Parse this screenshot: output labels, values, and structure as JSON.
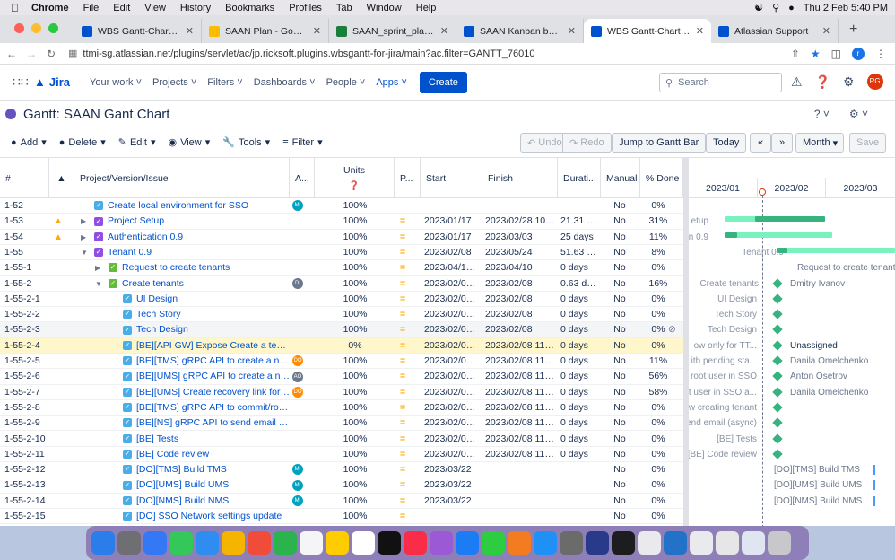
{
  "menubar": {
    "apple": "",
    "app": "Chrome",
    "items": [
      "File",
      "Edit",
      "View",
      "History",
      "Bookmarks",
      "Profiles",
      "Tab",
      "Window",
      "Help"
    ],
    "clock": "Thu 2 Feb  5:40 PM"
  },
  "tabs": [
    {
      "label": "WBS Gantt-Chart - Jira",
      "color": "#0052cc",
      "active": false
    },
    {
      "label": "SAAN Plan - Google Drive",
      "color": "#fbbc04",
      "active": false
    },
    {
      "label": "SAAN_sprint_planning.xl",
      "color": "#188038",
      "active": false
    },
    {
      "label": "SAAN Kanban board - Agi",
      "color": "#0052cc",
      "active": false
    },
    {
      "label": "WBS Gantt-Chart - Jira",
      "color": "#0052cc",
      "active": true
    },
    {
      "label": "Atlassian Support",
      "color": "#0052cc",
      "active": false
    }
  ],
  "address": {
    "url": "ttmi-sg.atlassian.net/plugins/servlet/ac/jp.ricksoft.plugins.wbsgantt-for-jira/main?ac.filter=GANTT_76010"
  },
  "jira": {
    "product": "Jira",
    "nav": [
      "Your work",
      "Projects",
      "Filters",
      "Dashboards",
      "People",
      "Apps"
    ],
    "active_nav": "Apps",
    "create_label": "Create",
    "search_placeholder": "Search",
    "avatar_initials": "RG"
  },
  "gantt_title": "Gantt:  SAAN Gant Chart",
  "toolbar": {
    "add": "Add",
    "delete": "Delete",
    "edit": "Edit",
    "view": "View",
    "tools": "Tools",
    "filter": "Filter",
    "undo": "Undo",
    "redo": "Redo",
    "jump": "Jump to Gantt Bar",
    "today": "Today",
    "scale": "Month",
    "save": "Save"
  },
  "columns": {
    "num": "#",
    "issue": "Project/Version/Issue",
    "assignee": "A...",
    "units": "Units",
    "priority": "P...",
    "start": "Start",
    "finish": "Finish",
    "duration": "Durati...",
    "manual": "Manual",
    "done": "% Done"
  },
  "timeline": {
    "months": [
      "2023/01",
      "2023/02",
      "2023/03"
    ]
  },
  "rows": [
    {
      "id": "1-55-2-4 ",
      "id_shown": "1-52",
      "warn": false,
      "indent": 0,
      "twist": "",
      "type": "check",
      "issue": "Create local environment for SSO",
      "assignee": "MI",
      "assignee_color": "#00a3bf",
      "units": "100%",
      "priority": "",
      "start": "",
      "finish": "",
      "duration": "",
      "manual": "No",
      "done": "0%"
    },
    {
      "id_shown": "1-53",
      "warn": true,
      "indent": 1,
      "twist": "▶",
      "type": "epic",
      "issue": "Project Setup",
      "assignee": "",
      "units": "100%",
      "priority": "=",
      "start": "2023/01/17",
      "finish": "2023/02/28 10:30",
      "duration": "21.31 d...",
      "manual": "No",
      "done": "31%"
    },
    {
      "id_shown": "1-54",
      "warn": true,
      "indent": 1,
      "twist": "▶",
      "type": "epic",
      "issue": "Authentication 0.9",
      "assignee": "",
      "units": "100%",
      "priority": "=",
      "start": "2023/01/17",
      "finish": "2023/03/03",
      "duration": "25 days",
      "manual": "No",
      "done": "11%"
    },
    {
      "id_shown": "1-55",
      "warn": false,
      "indent": 1,
      "twist": "▼",
      "type": "epic",
      "issue": "Tenant 0.9",
      "assignee": "",
      "units": "100%",
      "priority": "=",
      "start": "2023/02/08",
      "finish": "2023/05/24",
      "duration": "51.63 d...",
      "manual": "No",
      "done": "8%"
    },
    {
      "id_shown": "1-55-1",
      "warn": false,
      "indent": 2,
      "twist": "▶",
      "type": "story",
      "issue": "Request to create tenants",
      "assignee": "",
      "units": "100%",
      "priority": "=",
      "start": "2023/04/10 ...",
      "finish": "2023/04/10",
      "duration": "0 days",
      "manual": "No",
      "done": "0%"
    },
    {
      "id_shown": "1-55-2",
      "warn": false,
      "indent": 2,
      "twist": "▼",
      "type": "story",
      "issue": "Create tenants",
      "assignee": "DI",
      "assignee_color": "#6b778c",
      "units": "100%",
      "priority": "=",
      "start": "2023/02/08 ...",
      "finish": "2023/02/08",
      "duration": "0.63 da...",
      "manual": "No",
      "done": "16%"
    },
    {
      "id_shown": "1-55-2-1",
      "warn": false,
      "indent": 3,
      "twist": "",
      "type": "task",
      "issue": "UI Design",
      "assignee": "",
      "units": "100%",
      "priority": "=",
      "start": "2023/02/08 ...",
      "finish": "2023/02/08",
      "duration": "0 days",
      "manual": "No",
      "done": "0%"
    },
    {
      "id_shown": "1-55-2-2",
      "warn": false,
      "indent": 3,
      "twist": "",
      "type": "task",
      "issue": "Tech Story",
      "assignee": "",
      "units": "100%",
      "priority": "=",
      "start": "2023/02/08 ...",
      "finish": "2023/02/08",
      "duration": "0 days",
      "manual": "No",
      "done": "0%"
    },
    {
      "id_shown": "1-55-2-3",
      "warn": false,
      "indent": 3,
      "twist": "",
      "type": "task",
      "issue": "Tech Design",
      "assignee": "",
      "units": "100%",
      "priority": "=",
      "start": "2023/02/08 ...",
      "finish": "2023/02/08",
      "duration": "0 days",
      "manual": "No",
      "done": "0%"
    },
    {
      "id_shown": "1-55-2-4",
      "warn": false,
      "indent": 3,
      "twist": "",
      "type": "task",
      "issue": "[BE][API GW] Expose Create a tena...",
      "assignee": "",
      "units": "0%",
      "priority": "=",
      "start": "2023/02/08 ...",
      "finish": "2023/02/08 11:00",
      "duration": "0 days",
      "manual": "No",
      "done": "0%"
    },
    {
      "id_shown": "1-55-2-5",
      "warn": false,
      "indent": 3,
      "twist": "",
      "type": "task",
      "issue": "[BE][TMS] gRPC API to create a new...",
      "assignee": "DO",
      "assignee_color": "#ff8b00",
      "units": "100%",
      "priority": "=",
      "start": "2023/02/08 ...",
      "finish": "2023/02/08 11:00",
      "duration": "0 days",
      "manual": "No",
      "done": "11%"
    },
    {
      "id_shown": "1-55-2-6",
      "warn": false,
      "indent": 3,
      "twist": "",
      "type": "task",
      "issue": "[BE][UMS] gRPC API to create a ne...",
      "assignee": "AO",
      "assignee_color": "#6b778c",
      "units": "100%",
      "priority": "=",
      "start": "2023/02/08 ...",
      "finish": "2023/02/08 11:00",
      "duration": "0 days",
      "manual": "No",
      "done": "56%"
    },
    {
      "id_shown": "1-55-2-7",
      "warn": false,
      "indent": 3,
      "twist": "",
      "type": "task",
      "issue": "[BE][UMS] Create recovery link for ...",
      "assignee": "DO",
      "assignee_color": "#ff8b00",
      "units": "100%",
      "priority": "=",
      "start": "2023/02/08 ...",
      "finish": "2023/02/08 11:00",
      "duration": "0 days",
      "manual": "No",
      "done": "58%"
    },
    {
      "id_shown": "1-55-2-8",
      "warn": false,
      "indent": 3,
      "twist": "",
      "type": "task",
      "issue": "[BE][TMS] gRPC API to commit/rollb...",
      "assignee": "",
      "units": "100%",
      "priority": "=",
      "start": "2023/02/08 ...",
      "finish": "2023/02/08 11:00",
      "duration": "0 days",
      "manual": "No",
      "done": "0%"
    },
    {
      "id_shown": "1-55-2-9",
      "warn": false,
      "indent": 3,
      "twist": "",
      "type": "task",
      "issue": "[BE][NS] gRPC API to send email (as...",
      "assignee": "",
      "units": "100%",
      "priority": "=",
      "start": "2023/02/08 ...",
      "finish": "2023/02/08 11:00",
      "duration": "0 days",
      "manual": "No",
      "done": "0%"
    },
    {
      "id_shown": "1-55-2-10",
      "warn": false,
      "indent": 3,
      "twist": "",
      "type": "task",
      "issue": "[BE] Tests",
      "assignee": "",
      "units": "100%",
      "priority": "=",
      "start": "2023/02/08 ...",
      "finish": "2023/02/08 11:00",
      "duration": "0 days",
      "manual": "No",
      "done": "0%"
    },
    {
      "id_shown": "1-55-2-11",
      "warn": false,
      "indent": 3,
      "twist": "",
      "type": "task",
      "issue": "[BE] Code review",
      "assignee": "",
      "units": "100%",
      "priority": "=",
      "start": "2023/02/08 ...",
      "finish": "2023/02/08 11:00",
      "duration": "0 days",
      "manual": "No",
      "done": "0%"
    },
    {
      "id_shown": "1-55-2-12",
      "warn": false,
      "indent": 3,
      "twist": "",
      "type": "task",
      "issue": "[DO][TMS] Build TMS",
      "assignee": "MI",
      "assignee_color": "#00a3bf",
      "units": "100%",
      "priority": "=",
      "start": "2023/03/22",
      "finish": "",
      "duration": "",
      "manual": "No",
      "done": "0%"
    },
    {
      "id_shown": "1-55-2-13",
      "warn": false,
      "indent": 3,
      "twist": "",
      "type": "task",
      "issue": "[DO][UMS] Build UMS",
      "assignee": "MI",
      "assignee_color": "#00a3bf",
      "units": "100%",
      "priority": "=",
      "start": "2023/03/22",
      "finish": "",
      "duration": "",
      "manual": "No",
      "done": "0%"
    },
    {
      "id_shown": "1-55-2-14",
      "warn": false,
      "indent": 3,
      "twist": "",
      "type": "task",
      "issue": "[DO][NMS] Build NMS",
      "assignee": "MI",
      "assignee_color": "#00a3bf",
      "units": "100%",
      "priority": "=",
      "start": "2023/03/22",
      "finish": "",
      "duration": "",
      "manual": "No",
      "done": "0%"
    },
    {
      "id_shown": "1-55-2-15",
      "warn": false,
      "indent": 3,
      "twist": "",
      "type": "task",
      "issue": "[DO] SSO Network settings update",
      "assignee": "",
      "units": "100%",
      "priority": "=",
      "start": "",
      "finish": "",
      "duration": "",
      "manual": "No",
      "done": "0%"
    }
  ],
  "gantt_rows": [
    {
      "label": "",
      "name": ""
    },
    {
      "label": "etup",
      "name": ""
    },
    {
      "label": "n 0.9",
      "name": ""
    },
    {
      "label": "Tenant 0.9",
      "name": ""
    },
    {
      "label": "",
      "name": "Request to create tenants"
    },
    {
      "label": "Create tenants",
      "name": "Dmitry Ivanov"
    },
    {
      "label": "UI Design",
      "name": ""
    },
    {
      "label": "Tech Story",
      "name": ""
    },
    {
      "label": "Tech Design",
      "name": ""
    },
    {
      "label": "ow only for TT...",
      "name": "Unassigned"
    },
    {
      "label": "ith pending sta...",
      "name": "Danila Omelchenko"
    },
    {
      "label": "t root user in SSO",
      "name": "Anton Osetrov"
    },
    {
      "label": "t user in SSO a...",
      "name": "Danila Omelchenko"
    },
    {
      "label": "w creating tenant",
      "name": ""
    },
    {
      "label": "end email (async)",
      "name": ""
    },
    {
      "label": "[BE] Tests",
      "name": ""
    },
    {
      "label": "[BE] Code review",
      "name": ""
    },
    {
      "label": "",
      "name": "[DO][TMS] Build TMS"
    },
    {
      "label": "",
      "name": "[DO][UMS] Build UMS"
    },
    {
      "label": "",
      "name": "[DO][NMS] Build NMS"
    },
    {
      "label": "",
      "name": ""
    }
  ],
  "colors": {
    "accent": "#0052cc",
    "bar": "#36b37e",
    "warn": "#ffab00",
    "highlight": "#fff6cc"
  }
}
